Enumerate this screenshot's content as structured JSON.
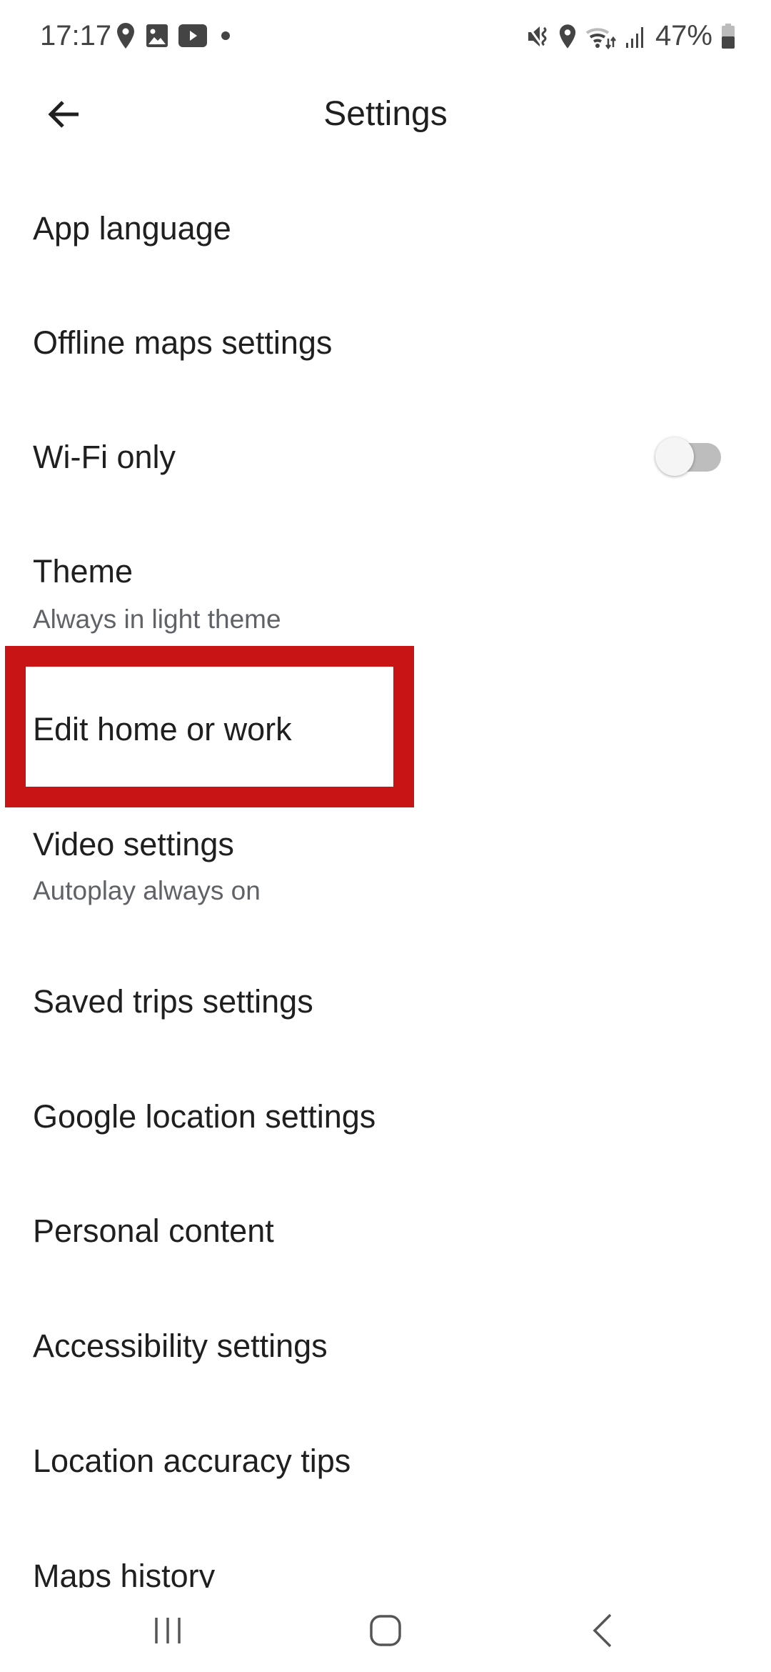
{
  "status_bar": {
    "time": "17:17",
    "left_icons": [
      "location-icon",
      "gallery-icon",
      "youtube-icon",
      "dot-icon"
    ],
    "right_icons": [
      "mute-vibrate-icon",
      "location-icon",
      "wifi-icon",
      "signal-icon",
      "battery-icon"
    ],
    "battery": "47%"
  },
  "app_bar": {
    "title": "Settings",
    "back_icon": "arrow-left-icon"
  },
  "settings": [
    {
      "label": "App language"
    },
    {
      "label": "Offline maps settings"
    },
    {
      "label": "Wi-Fi only",
      "toggle": false
    },
    {
      "label": "Theme",
      "subtitle": "Always in light theme"
    },
    {
      "label": "Edit home or work",
      "highlighted": true
    },
    {
      "label": "Video settings",
      "subtitle": "Autoplay always on"
    },
    {
      "label": "Saved trips settings"
    },
    {
      "label": "Google location settings"
    },
    {
      "label": "Personal content"
    },
    {
      "label": "Accessibility settings"
    },
    {
      "label": "Location accuracy tips"
    },
    {
      "label": "Maps history"
    }
  ],
  "highlight_color": "#c81414",
  "nav_bar": [
    "recents-icon",
    "home-icon",
    "back-icon"
  ]
}
